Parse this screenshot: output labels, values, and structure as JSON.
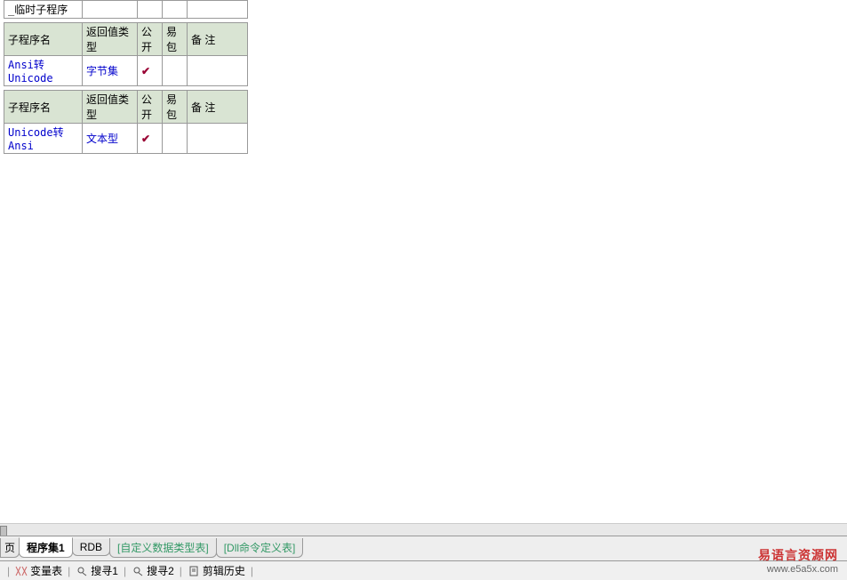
{
  "tables": {
    "t0_row_name": "_临时子程序",
    "headers": {
      "name": "子程序名",
      "return_type": "返回值类型",
      "public": "公开",
      "pack": "易包",
      "remark": "备  注"
    },
    "t1": {
      "name": "Ansi转Unicode",
      "return_type": "字节集",
      "check": "✔"
    },
    "t2": {
      "name": "Unicode转Ansi",
      "return_type": "文本型",
      "check": "✔"
    }
  },
  "tabs": {
    "t0": "页",
    "t1": "程序集1",
    "t2": "RDB",
    "t3": "[自定义数据类型表]",
    "t4": "[Dll命令定义表]"
  },
  "bottom": {
    "var_table": "变量表",
    "search1": "搜寻1",
    "search2": "搜寻2",
    "clip_history": "剪辑历史"
  },
  "watermark": {
    "line1": "易语言资源网",
    "line2": "www.e5a5x.com"
  }
}
